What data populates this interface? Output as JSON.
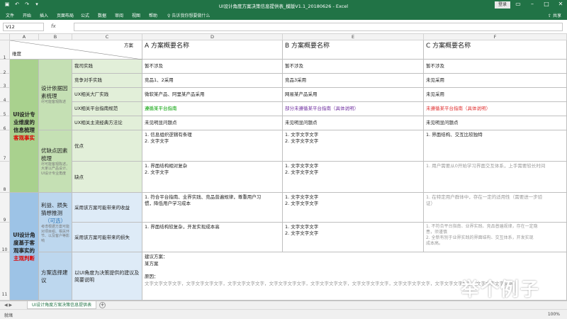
{
  "window": {
    "title": "UI设计角度方案决策信息提供表_模版V1.1_20180626 - Excel",
    "login_label": "登录",
    "qat_icons": [
      "save-icon",
      "undo-icon",
      "redo-icon",
      "customize-icon"
    ]
  },
  "ribbon": {
    "tabs": [
      "文件",
      "开始",
      "插入",
      "页面布局",
      "公式",
      "数据",
      "审阅",
      "视图",
      "帮助"
    ],
    "tell_me": "告诉我你想要做什么",
    "share_label": "共享"
  },
  "formula_bar": {
    "name_box": "V12",
    "fx_label": "fx",
    "value": ""
  },
  "columns": [
    "A",
    "B",
    "C",
    "D",
    "E",
    "F"
  ],
  "rows": [
    "1",
    "2",
    "3",
    "4",
    "5",
    "6",
    "7",
    "8",
    "9",
    "10",
    "11"
  ],
  "header": {
    "corner_top": "方案",
    "corner_bottom": "维度",
    "colD": "A 方案概要名称",
    "colE": "B 方案概要名称",
    "colF": "C 方案概要名称"
  },
  "sectionA1": {
    "line1": "UI设计专业维度的信息梳理",
    "line2": "客观事实"
  },
  "sectionA2": {
    "line1": "UI设计角度基于客观事实的",
    "line2": "主观判断"
  },
  "groupB": {
    "design_basis": "设计依据因素梳理",
    "design_basis_note": "尽可能客观陈述",
    "pros_cons": "优缺点因素梳理",
    "pros_cons_note": "尽可能客观陈述，大家以产品设计、UI设计专业角度",
    "benefit": "利益、损失猜想推测",
    "benefit_opt": "（可选）",
    "benefit_note": "考虑根据方案可能对项目组、相关环节、以及客户等影响",
    "choice": "方案选择建议"
  },
  "groupC": {
    "our_practice": "我司实践",
    "competitor": "竞争对手实践",
    "ux_big": "UX相关大厂实践",
    "ux_guide": "UX相关平台指南规范",
    "ux_theory": "UX相关主流经典方法论",
    "pros": "优点",
    "cons": "缺点",
    "benefit_use": "采用该方案可能带来的收益",
    "loss_use": "采用该方案可能带来的损失",
    "suggestion": "以UI角度为决策提供的建议及简要说明"
  },
  "colD": {
    "our_practice": "暂不涉及",
    "competitor": "竞品1、2采用",
    "ux_big": "微软某产品、阿里某产品采用",
    "ux_guide": "遵循某平台指南",
    "ux_theory": "未见明显问题点",
    "pros": [
      "1. 信息组织逻辑有条理",
      "2. 文字文字"
    ],
    "cons": [
      "1. 界面结构相对复杂",
      "2. 文字文字"
    ],
    "benefit": [
      "1. 符合平台指南、业界实践、竞品普遍规律，尊重用户习",
      "惯，降低用户学习成本"
    ],
    "loss": "1. 界面结构较复杂，开发实现成本高",
    "suggestion": [
      "建议方案：",
      "某方案",
      "",
      "原因：",
      "文字文字文字文字，文字文字文字文字，文字文字文字文字，文字文字文字文字，文字文字文字文字，文字文字文字文字，文字文字文字文字，文字文字文字文字，文字文字文字文字，"
    ]
  },
  "colE": {
    "our_practice": "暂不涉及",
    "competitor": "竞品3采用",
    "ux_big": "网易某产品采用",
    "ux_guide": "部分未遵循某平台指南（具体说明）",
    "ux_theory": "未见明显问题点",
    "pros": [
      "1. 文字文字文字",
      "2. 文字文字文字"
    ],
    "cons": [
      "1. 文字文字文字",
      "2. 文字文字文字"
    ],
    "benefit": [
      "1. 文字文字文字",
      "2. 文字文字文字"
    ],
    "loss": [
      "1. 文字文字文字",
      "2. 文字文字文字"
    ]
  },
  "colF": {
    "our_practice": "暂不涉及",
    "competitor": "未见采用",
    "ux_big": "未见采用",
    "ux_guide": "未遵循某平台指南（具体说明）",
    "ux_theory": "未见明显问题点",
    "pros": "1. 界面结构、交互比较独特",
    "cons": "1. 用户需要从0开始学习界面交互体系，上手需要较长时间",
    "benefit": [
      "1. 在特定用户群体中，存在一定的适用性（需要进一步验",
      "证）"
    ],
    "loss": [
      "1. 不符合平台指南、业界实践、竞品普遍规律，存在一定隐",
      "患，须谨慎",
      "2. 全新有别于业界实践的界面结构、交互体系，开发实现",
      "成本高。"
    ]
  },
  "watermark": "举个例子",
  "sheet": {
    "tab_label": "UI设计角度方案决策信息提供表",
    "add_label": "+",
    "status": "就绪",
    "zoom": "100%"
  },
  "colors": {
    "excel_green": "#217346",
    "green_section": "#a9d18e",
    "blue_section": "#9dc3e6",
    "purple_text": "#7030a0",
    "red_text": "#e03030"
  }
}
